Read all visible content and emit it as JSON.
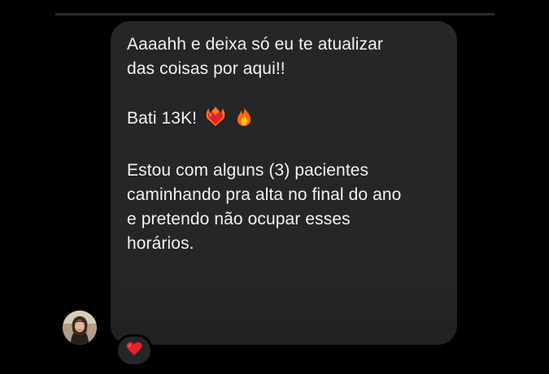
{
  "chat": {
    "message": {
      "line1": "Aaaahh e deixa só eu te atualizar",
      "line2": "das coisas por aqui!!",
      "line3": "Bati 13K!",
      "line4": "Estou com alguns (3) pacientes",
      "line5": "caminhando pra alta no final do ano",
      "line6": "e pretendo não ocupar esses",
      "line7": "horários.",
      "emojis": [
        "heart-on-fire-icon",
        "fire-icon"
      ]
    },
    "reaction": "heart-icon",
    "colors": {
      "background": "#000000",
      "bubble": "#262628",
      "text": "#f2f2f2",
      "heart": "#e8202e",
      "fire": "#ff7a1a"
    }
  }
}
